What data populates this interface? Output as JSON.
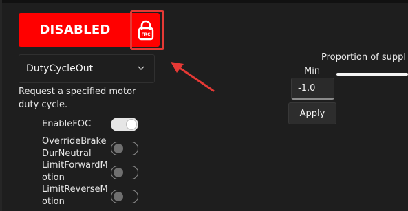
{
  "control": {
    "enable_label": "DISABLED",
    "lock_badge": "FRC",
    "lock_icon": "padlock-icon",
    "highlight_color": "#e53935",
    "button_color": "#ff0000"
  },
  "request": {
    "selected": "DutyCycleOut",
    "description": "Request a specified motor duty cycle."
  },
  "options": [
    {
      "label_line1": "EnableFOC",
      "label_line2": "",
      "on": true
    },
    {
      "label_line1": "OverrideBrake",
      "label_line2": "DurNeutral",
      "on": false
    },
    {
      "label_line1": "LimitForwardM",
      "label_line2": "otion",
      "on": false
    },
    {
      "label_line1": "LimitReverseM",
      "label_line2": "otion",
      "on": false
    }
  ],
  "output": {
    "title": "Proportion of suppl",
    "min_label": "Min",
    "min_value": "-1.0",
    "apply_label": "Apply"
  }
}
